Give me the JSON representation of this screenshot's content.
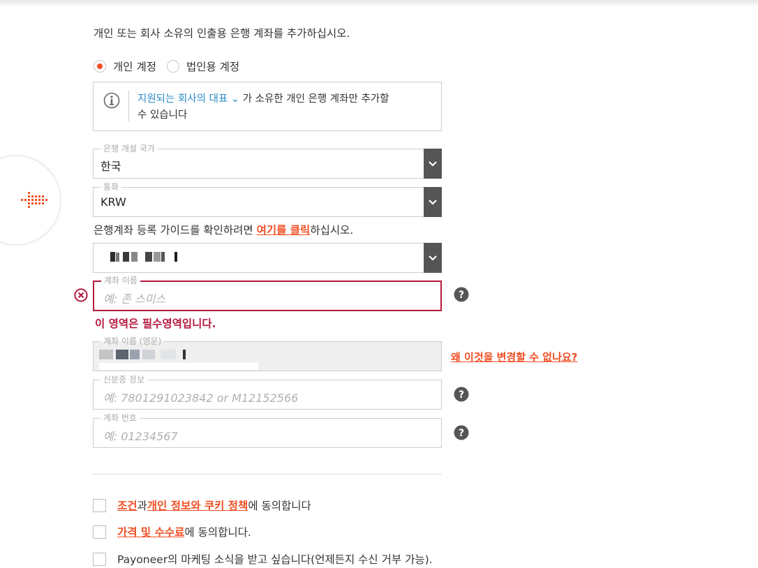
{
  "intro": {
    "text": "개인 또는 회사 소유의 인출용 은행 계좌를 추가하십시오."
  },
  "account_type": {
    "options": [
      {
        "label": "개인 계정",
        "selected": true
      },
      {
        "label": "법인용 계정",
        "selected": false
      }
    ]
  },
  "info": {
    "link_text": "지원되는 회사의 대표",
    "text_after": "가 소유한 개인 은행 계좌만 추가할",
    "text_line2": "수 있습니다"
  },
  "fields": {
    "bank_country": {
      "label": "은행 개설 국가",
      "value": "한국"
    },
    "currency": {
      "label": "통화",
      "value": "KRW"
    },
    "account_name": {
      "label": "계좌 이름",
      "placeholder": "예: 존 스미스"
    },
    "account_name_en": {
      "label": "계좌 이름 (영문)"
    },
    "id_info": {
      "label": "신분증 정보",
      "placeholder": "예: 7801291023842 or M12152566"
    },
    "account_number": {
      "label": "계좌 번호",
      "placeholder": "예: 01234567"
    }
  },
  "guide": {
    "before": "은행계좌 등록 가이드를 확인하려면 ",
    "link": "여기를 클릭",
    "after": "하십시오."
  },
  "error": {
    "message": "이 영역은 필수영역입니다."
  },
  "why_link": {
    "text": "왜 이것을 변경할 수 없나요?"
  },
  "agreements": {
    "terms": {
      "link1": "조건",
      "mid": "과",
      "link2": "개인 정보와 쿠키 정책",
      "after": "에 동의합니다"
    },
    "fees": {
      "link": "가격 및 수수료",
      "after": "에 동의합니다."
    },
    "marketing": {
      "text": "Payoneer의 마케팅 소식을 받고 싶습니다(언제든지 수신 거부 가능)."
    }
  },
  "colors": {
    "accent": "#f04e23",
    "error": "#b5193e",
    "link_blue": "#2a8cc7",
    "select_button": "#555555"
  }
}
